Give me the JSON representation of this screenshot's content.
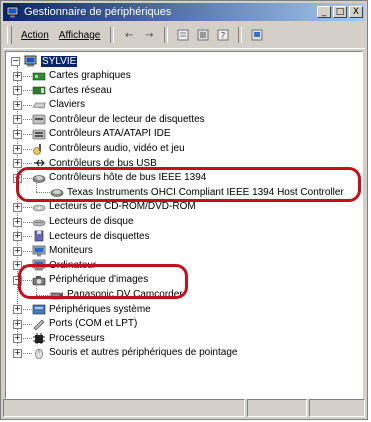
{
  "window": {
    "title": "Gestionnaire de périphériques",
    "controls": [
      "_",
      "□",
      "X"
    ]
  },
  "menu": {
    "action": "Action",
    "view": "Affichage"
  },
  "toolbar_icons": [
    "back-icon",
    "forward-icon",
    "properties-icon",
    "view-icon",
    "help-icon",
    "scan-icon"
  ],
  "tree": {
    "root": "SYLVIE",
    "items": [
      {
        "label": "Cartes graphiques",
        "icon": "display-adapter-icon",
        "state": "+"
      },
      {
        "label": "Cartes réseau",
        "icon": "network-adapter-icon",
        "state": "+"
      },
      {
        "label": "Claviers",
        "icon": "keyboard-icon",
        "state": "+"
      },
      {
        "label": "Contrôleur de lecteur de disquettes",
        "icon": "floppy-controller-icon",
        "state": "+"
      },
      {
        "label": "Contrôleurs ATA/ATAPI IDE",
        "icon": "ide-controller-icon",
        "state": "+"
      },
      {
        "label": "Contrôleurs audio, vidéo et jeu",
        "icon": "sound-icon",
        "state": "+"
      },
      {
        "label": "Contrôleurs de bus USB",
        "icon": "usb-icon",
        "state": "+"
      },
      {
        "label": "Contrôleurs hôte de bus IEEE 1394",
        "icon": "ieee1394-icon",
        "state": "-"
      },
      {
        "label": "Texas Instruments OHCI Compliant IEEE 1394 Host Controller",
        "icon": "ieee1394-device-icon",
        "child": true
      },
      {
        "label": "Lecteurs de CD-ROM/DVD-ROM",
        "icon": "cdrom-icon",
        "state": "+"
      },
      {
        "label": "Lecteurs de disque",
        "icon": "disk-drive-icon",
        "state": "+"
      },
      {
        "label": "Lecteurs de disquettes",
        "icon": "floppy-drive-icon",
        "state": "+"
      },
      {
        "label": "Moniteurs",
        "icon": "monitor-icon",
        "state": "+"
      },
      {
        "label": "Ordinateur",
        "icon": "computer-icon",
        "state": "+"
      },
      {
        "label": "Périphérique d'images",
        "icon": "imaging-device-icon",
        "state": "-"
      },
      {
        "label": "Panasonic DV Camcorder",
        "icon": "camcorder-icon",
        "child": true
      },
      {
        "label": "Périphériques système",
        "icon": "system-devices-icon",
        "state": "+"
      },
      {
        "label": "Ports (COM et LPT)",
        "icon": "ports-icon",
        "state": "+"
      },
      {
        "label": "Processeurs",
        "icon": "processor-icon",
        "state": "+"
      },
      {
        "label": "Souris et autres périphériques de pointage",
        "icon": "mouse-icon",
        "state": "+"
      }
    ]
  },
  "colors": {
    "title_bar": "#0a246a",
    "highlight": "#c4101e",
    "window_bg": "#d4d0c8"
  }
}
